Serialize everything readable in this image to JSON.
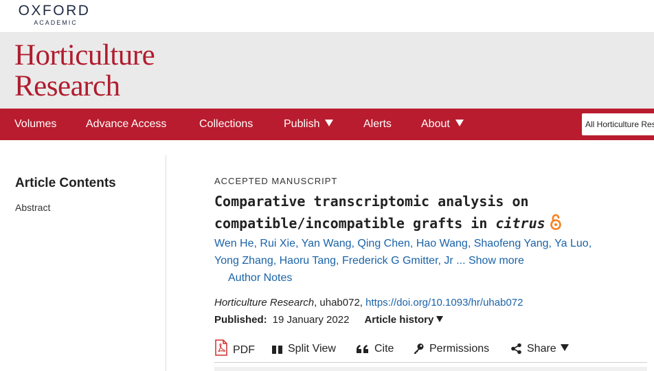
{
  "brand": {
    "publisher": "OXFORD",
    "subline": "ACADEMIC"
  },
  "journal": {
    "title_line1": "Horticulture",
    "title_line2": "Research"
  },
  "nav": {
    "items": [
      "Volumes",
      "Advance Access",
      "Collections",
      "Publish",
      "Alerts",
      "About"
    ],
    "search_scope": "All Horticulture Research"
  },
  "sidebar": {
    "heading": "Article Contents",
    "links": [
      "Abstract"
    ]
  },
  "article": {
    "type": "ACCEPTED MANUSCRIPT",
    "title_main": "Comparative transcriptomic analysis on compatible/incompatible grafts in",
    "title_italic": "citrus",
    "authors_line1": [
      "Wen He",
      "Rui Xie",
      "Yan Wang",
      "Qing Chen",
      "Hao Wang",
      "Shaofeng Yang",
      "Ya Luo"
    ],
    "authors_line2": [
      "Yong Zhang",
      "Haoru Tang",
      "Frederick G Gmitter, Jr"
    ],
    "ellipsis": "...",
    "show_more": "Show more",
    "author_notes": "Author Notes",
    "journal_name": "Horticulture Research",
    "article_id": ", uhab072, ",
    "doi": "https://doi.org/10.1093/hr/uhab072",
    "published_label": "Published:",
    "published_date": "19 January 2022",
    "history_label": "Article history"
  },
  "toolbar": {
    "pdf": "PDF",
    "split_view": "Split View",
    "cite": "Cite",
    "permissions": "Permissions",
    "share": "Share"
  },
  "colors": {
    "brand_red": "#b91c2e",
    "link_blue": "#1a63a8",
    "open_access_orange": "#f58220"
  }
}
